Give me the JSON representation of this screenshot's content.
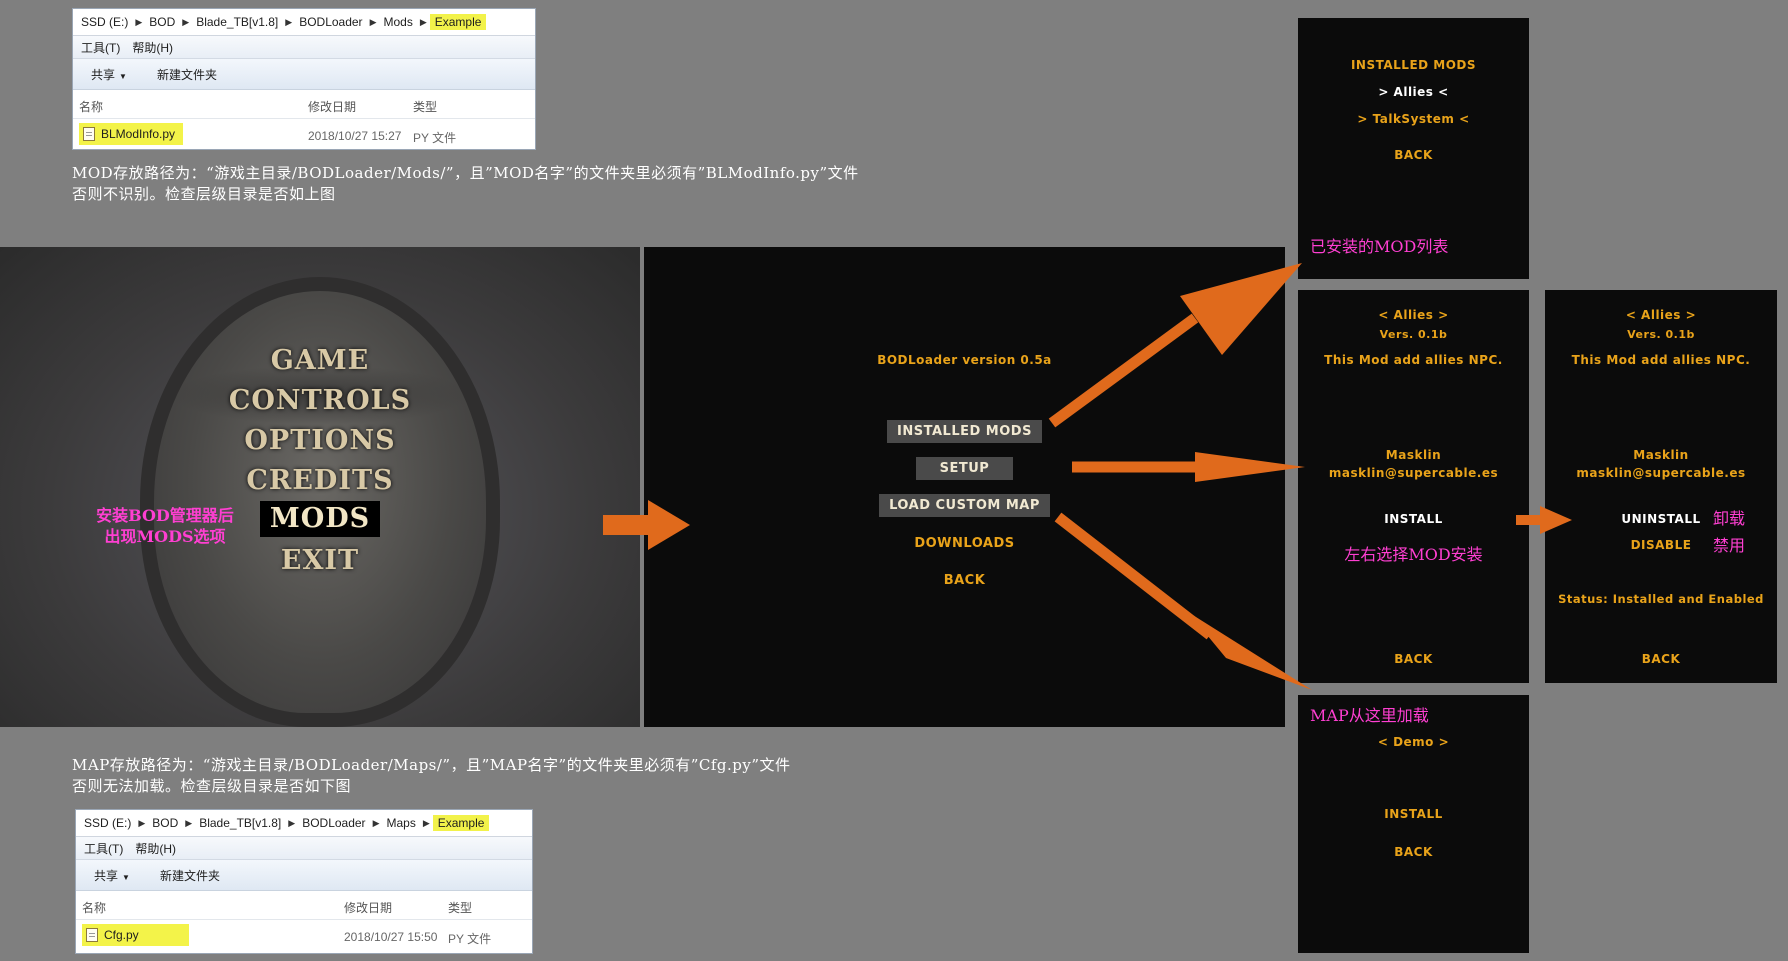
{
  "explorer_top": {
    "breadcrumb": [
      "SSD (E:)",
      "BOD",
      "Blade_TB[v1.8]",
      "BODLoader",
      "Mods",
      "Example"
    ],
    "menu": [
      "工具(T)",
      "帮助(H)"
    ],
    "toolbar": {
      "share": "共享",
      "new_folder": "新建文件夹"
    },
    "columns": {
      "name": "名称",
      "date": "修改日期",
      "type": "类型"
    },
    "file": {
      "name": "BLModInfo.py",
      "date": "2018/10/27 15:27",
      "type": "PY 文件"
    }
  },
  "note_top": {
    "line1": "MOD存放路径为：“游戏主目录/BODLoader/Mods/”，且”MOD名字”的文件夹里必须有”BLModInfo.py”文件",
    "line2": "否则不识别。检查层级目录是否如上图"
  },
  "main_menu": {
    "items": [
      "GAME",
      "CONTROLS",
      "OPTIONS",
      "CREDITS",
      "MODS",
      "EXIT"
    ],
    "annotation_line1": "安装BOD管理器后",
    "annotation_line2": "出现MODS选项"
  },
  "loader": {
    "version": "BODLoader version 0.5a",
    "buttons": [
      "INSTALLED MODS",
      "SETUP",
      "LOAD CUSTOM MAP",
      "DOWNLOADS",
      "BACK"
    ]
  },
  "installed_screen": {
    "title": "INSTALLED MODS",
    "mods": [
      "> Allies <",
      "> TalkSystem <"
    ],
    "back": "BACK",
    "annotation": "已安装的MOD列表"
  },
  "mod_detail": {
    "name": "< Allies >",
    "version": "Vers. 0.1b",
    "description": "This Mod add allies NPC.",
    "author": "Masklin",
    "email": "masklin@supercable.es",
    "install": "INSTALL",
    "back": "BACK",
    "annotation": "左右选择MOD安装"
  },
  "mod_installed": {
    "name": "< Allies >",
    "version": "Vers. 0.1b",
    "description": "This Mod add allies NPC.",
    "author": "Masklin",
    "email": "masklin@supercable.es",
    "uninstall": "UNINSTALL",
    "disable": "DISABLE",
    "status": "Status: Installed and Enabled",
    "back": "BACK",
    "annotation_uninstall": "卸载",
    "annotation_disable": "禁用"
  },
  "map_screen": {
    "annotation": "MAP从这里加载",
    "map": "< Demo >",
    "install": "INSTALL",
    "back": "BACK"
  },
  "note_bottom": {
    "line1": "MAP存放路径为：“游戏主目录/BODLoader/Maps/”，且”MAP名字”的文件夹里必须有”Cfg.py”文件",
    "line2": "否则无法加载。检查层级目录是否如下图"
  },
  "explorer_bottom": {
    "breadcrumb": [
      "SSD (E:)",
      "BOD",
      "Blade_TB[v1.8]",
      "BODLoader",
      "Maps",
      "Example"
    ],
    "menu": [
      "工具(T)",
      "帮助(H)"
    ],
    "toolbar": {
      "share": "共享",
      "new_folder": "新建文件夹"
    },
    "columns": {
      "name": "名称",
      "date": "修改日期",
      "type": "类型"
    },
    "file": {
      "name": "Cfg.py",
      "date": "2018/10/27 15:50",
      "type": "PY 文件"
    }
  },
  "colors": {
    "arrow": "#e06a1c",
    "game_gold": "#e9a31a",
    "annotation_pink": "#ff3fd2",
    "highlight_yellow": "#f2f24a"
  }
}
